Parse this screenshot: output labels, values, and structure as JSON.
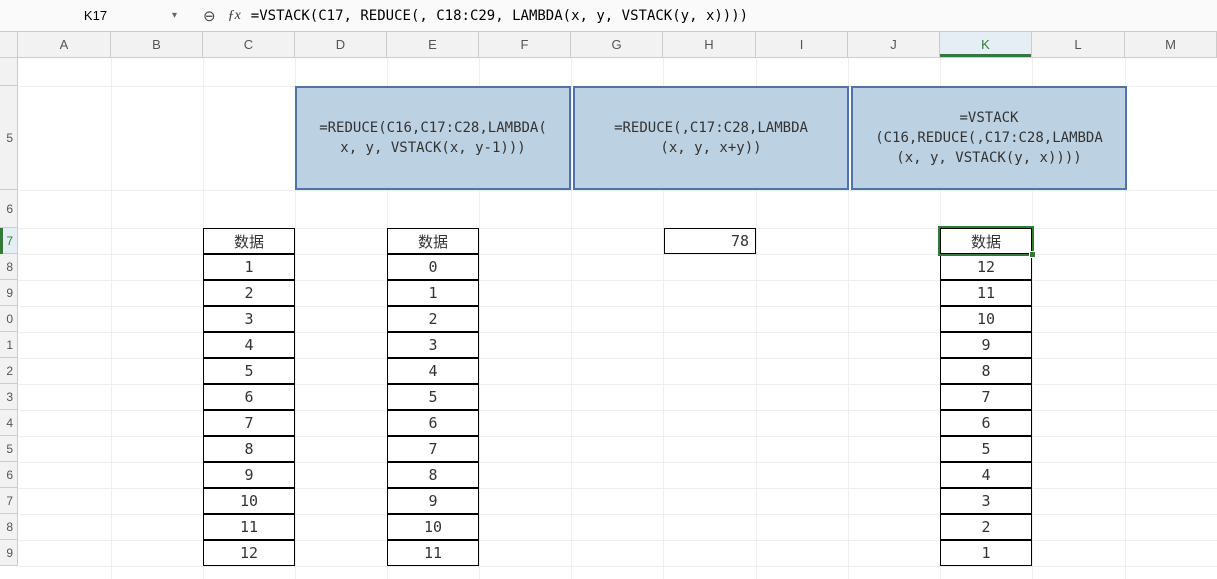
{
  "formula_bar": {
    "cell_ref": "K17",
    "formula": "=VSTACK(C17, REDUCE(, C18:C29, LAMBDA(x, y, VSTACK(y, x))))"
  },
  "columns": [
    "A",
    "B",
    "C",
    "D",
    "E",
    "F",
    "G",
    "H",
    "I",
    "J",
    "K",
    "L",
    "M"
  ],
  "selected_column": "K",
  "row_labels": [
    "",
    "5",
    "6",
    "7",
    "8",
    "9",
    "0",
    "1",
    "2",
    "3",
    "4",
    "5",
    "6",
    "7",
    "8",
    "9"
  ],
  "selected_row_index": 3,
  "merged_headers": {
    "block1": "=REDUCE(C16,C17:C28,LAMBDA(\nx, y, VSTACK(x, y-1)))",
    "block2": "=REDUCE(,C17:C28,LAMBDA\n(x, y, x+y))",
    "block3": "=VSTACK\n(C16,REDUCE(,C17:C28,LAMBDA\n(x, y, VSTACK(y, x))))"
  },
  "columns_data": {
    "C": {
      "header": "数据",
      "values": [
        "1",
        "2",
        "3",
        "4",
        "5",
        "6",
        "7",
        "8",
        "9",
        "10",
        "11",
        "12"
      ]
    },
    "E": {
      "header": "数据",
      "values": [
        "0",
        "1",
        "2",
        "3",
        "4",
        "5",
        "6",
        "7",
        "8",
        "9",
        "10",
        "11"
      ]
    },
    "H": {
      "single": "78"
    },
    "K": {
      "header": "数据",
      "values": [
        "12",
        "11",
        "10",
        "9",
        "8",
        "7",
        "6",
        "5",
        "4",
        "3",
        "2",
        "1"
      ]
    }
  },
  "chart_data": null
}
